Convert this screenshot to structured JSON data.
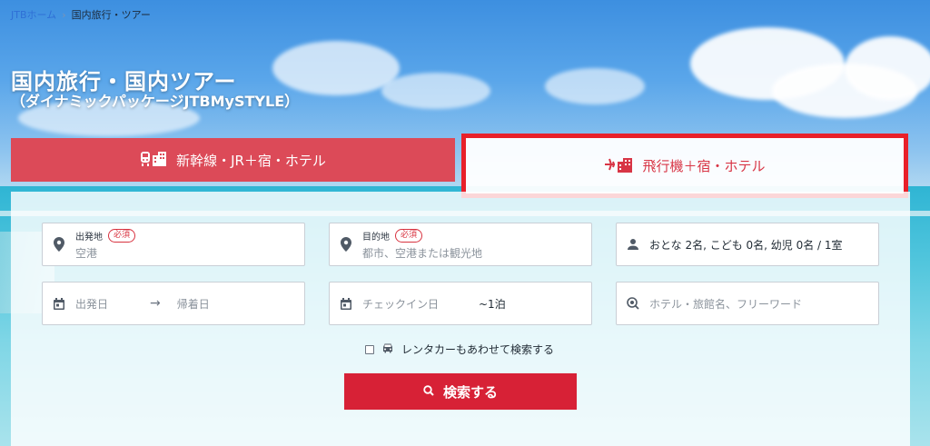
{
  "breadcrumb": {
    "home": "JTBホーム",
    "separator": ">",
    "current": "国内旅行・ツアー"
  },
  "header": {
    "title": "国内旅行・国内ツアー",
    "subtitle": "（ダイナミックパッケージJTBMySTYLE）"
  },
  "tabs": {
    "shinkansen": {
      "label": "新幹線・JR＋宿・ホテル",
      "icon": "train-hotel-icon"
    },
    "flight": {
      "label": "飛行機＋宿・ホテル",
      "icon": "plane-hotel-icon"
    }
  },
  "form": {
    "departure": {
      "label": "出発地",
      "required": "必須",
      "placeholder": "空港",
      "icon": "location-pin-icon"
    },
    "destination": {
      "label": "目的地",
      "required": "必須",
      "placeholder": "都市、空港または観光地",
      "icon": "location-pin-icon"
    },
    "guests": {
      "value": "おとな 2名, こども 0名, 幼児 0名 / 1室",
      "icon": "person-icon"
    },
    "depart_date": {
      "placeholder": "出発日",
      "icon": "calendar-icon"
    },
    "date_arrow": "→",
    "return_date": {
      "placeholder": "帰着日"
    },
    "checkin": {
      "placeholder": "チェックイン日",
      "nights": "~1泊",
      "icon": "calendar-icon"
    },
    "keyword": {
      "placeholder": "ホテル・旅館名、フリーワード",
      "icon": "search-icon"
    },
    "rental_car": {
      "label": "レンタカーもあわせて検索する",
      "icon": "car-icon"
    },
    "search_button": {
      "label": "検索する",
      "icon": "search-icon"
    }
  },
  "colors": {
    "tab_active_red": "#dc4a58",
    "highlight_border": "#e8202a",
    "button_red": "#d72136",
    "required_red": "#d8323f"
  }
}
